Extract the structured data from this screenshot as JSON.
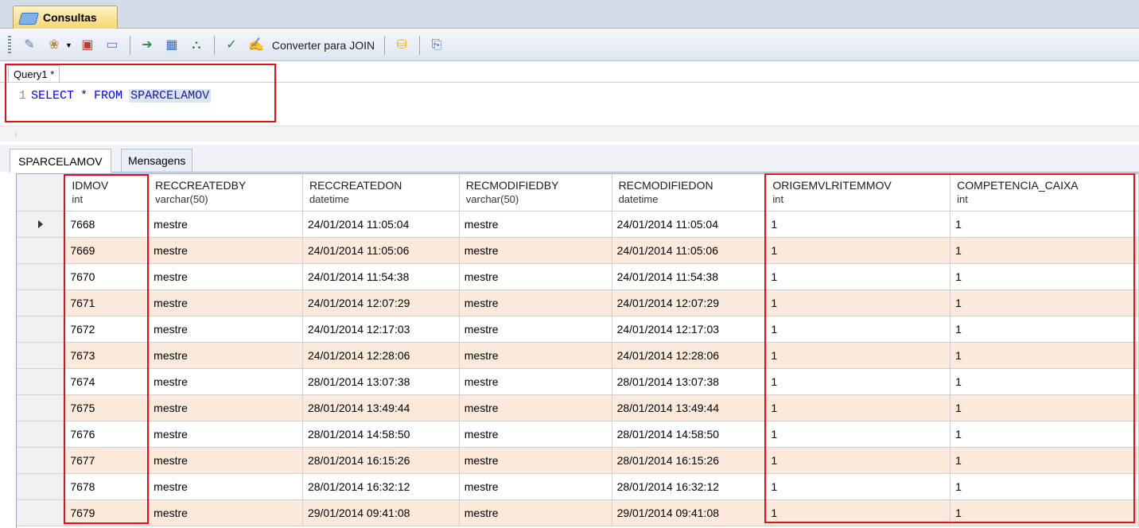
{
  "window": {
    "doc_tab": "Consultas"
  },
  "toolbar": {
    "buttons": [
      {
        "name": "new-query-icon",
        "glyph": "✎",
        "color": "#5b7fb8"
      },
      {
        "name": "open-icon",
        "glyph": "❀",
        "color": "#b0904a"
      },
      {
        "name": "save-icon",
        "glyph": "▣",
        "color": "#c0392b"
      },
      {
        "name": "window-icon",
        "glyph": "▭",
        "color": "#4a7ab8"
      },
      {
        "name": "execute-icon",
        "glyph": "➔",
        "color": "#1f8f3a"
      },
      {
        "name": "table-icon",
        "glyph": "▦",
        "color": "#3a6bc4"
      },
      {
        "name": "diagram-icon",
        "glyph": "⛬",
        "color": "#2e7d32"
      },
      {
        "name": "check-icon",
        "glyph": "✓",
        "color": "#2e7d32"
      },
      {
        "name": "format-icon",
        "glyph": "✍",
        "color": "#6d5aa0"
      }
    ],
    "join_label": "Converter para JOIN",
    "db_icon_color": "#e8b400",
    "export_icon_color": "#3a6bc4"
  },
  "editor": {
    "tab_label": "Query1 *",
    "line_number": "1",
    "kw_select": "SELECT",
    "star": "*",
    "kw_from": "FROM",
    "table_name": "SPARCELAMOV"
  },
  "results": {
    "tabs": [
      "SPARCELAMOV",
      "Mensagens"
    ],
    "columns": [
      {
        "name": "IDMOV",
        "type": "int"
      },
      {
        "name": "RECCREATEDBY",
        "type": "varchar(50)"
      },
      {
        "name": "RECCREATEDON",
        "type": "datetime"
      },
      {
        "name": "RECMODIFIEDBY",
        "type": "varchar(50)"
      },
      {
        "name": "RECMODIFIEDON",
        "type": "datetime"
      },
      {
        "name": "ORIGEMVLRITEMMOV",
        "type": "int"
      },
      {
        "name": "COMPETENCIA_CAIXA",
        "type": "int"
      }
    ],
    "rows": [
      [
        "7668",
        "mestre",
        "24/01/2014 11:05:04",
        "mestre",
        "24/01/2014 11:05:04",
        "1",
        "1"
      ],
      [
        "7669",
        "mestre",
        "24/01/2014 11:05:06",
        "mestre",
        "24/01/2014 11:05:06",
        "1",
        "1"
      ],
      [
        "7670",
        "mestre",
        "24/01/2014 11:54:38",
        "mestre",
        "24/01/2014 11:54:38",
        "1",
        "1"
      ],
      [
        "7671",
        "mestre",
        "24/01/2014 12:07:29",
        "mestre",
        "24/01/2014 12:07:29",
        "1",
        "1"
      ],
      [
        "7672",
        "mestre",
        "24/01/2014 12:17:03",
        "mestre",
        "24/01/2014 12:17:03",
        "1",
        "1"
      ],
      [
        "7673",
        "mestre",
        "24/01/2014 12:28:06",
        "mestre",
        "24/01/2014 12:28:06",
        "1",
        "1"
      ],
      [
        "7674",
        "mestre",
        "28/01/2014 13:07:38",
        "mestre",
        "28/01/2014 13:07:38",
        "1",
        "1"
      ],
      [
        "7675",
        "mestre",
        "28/01/2014 13:49:44",
        "mestre",
        "28/01/2014 13:49:44",
        "1",
        "1"
      ],
      [
        "7676",
        "mestre",
        "28/01/2014 14:58:50",
        "mestre",
        "28/01/2014 14:58:50",
        "1",
        "1"
      ],
      [
        "7677",
        "mestre",
        "28/01/2014 16:15:26",
        "mestre",
        "28/01/2014 16:15:26",
        "1",
        "1"
      ],
      [
        "7678",
        "mestre",
        "28/01/2014 16:32:12",
        "mestre",
        "28/01/2014 16:32:12",
        "1",
        "1"
      ],
      [
        "7679",
        "mestre",
        "29/01/2014 09:41:08",
        "mestre",
        "29/01/2014 09:41:08",
        "1",
        "1"
      ]
    ],
    "selected_row": 0,
    "alt_row_color": "#fbeadb"
  },
  "highlight_color": "#e1101a"
}
